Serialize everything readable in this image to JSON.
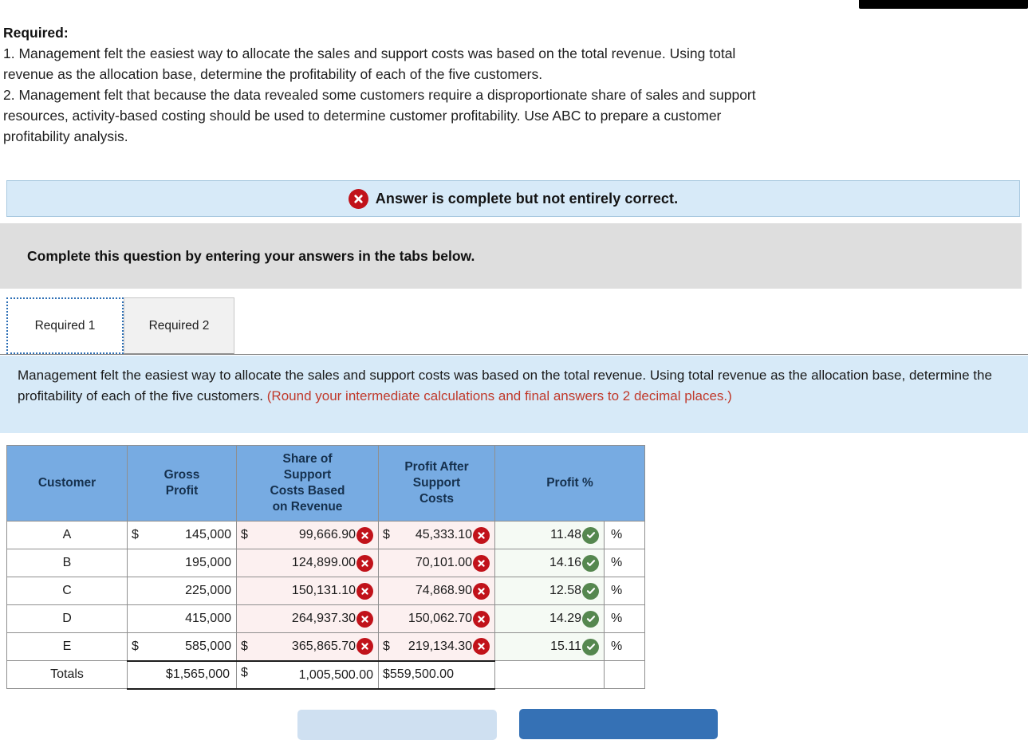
{
  "required": {
    "title": "Required:",
    "item1_line1": "1. Management felt the easiest way to allocate the sales and support costs was based on the total revenue. Using total",
    "item1_line2": "revenue as the allocation base, determine the profitability of each of the five customers.",
    "item2_line1": "2. Management felt that because the data revealed some customers require a disproportionate share of sales and support",
    "item2_line2": "resources, activity-based costing should be used to determine customer profitability. Use ABC to prepare a customer",
    "item2_line3": "profitability analysis."
  },
  "answer_banner": {
    "text": "Answer is complete but not entirely correct.",
    "icon": "x-circle-icon",
    "icon_color": "#c1121a",
    "background": "#d7eaf8"
  },
  "gray_banner": {
    "text": "Complete this question by entering your answers in the tabs below."
  },
  "tabs": [
    {
      "label": "Required 1",
      "active": true
    },
    {
      "label": "Required 2",
      "active": false
    }
  ],
  "question": {
    "body": "Management felt the easiest way to allocate the sales and support costs was based on the total revenue. Using total revenue as the allocation base, determine the profitability of each of the five customers. ",
    "note": "(Round your intermediate calculations and final answers to 2 decimal places.)",
    "note_color": "#c0392b"
  },
  "table": {
    "header_color": "#77abe2",
    "headers": {
      "customer": "Customer",
      "gross_profit": "Gross\nProfit",
      "gross_profit_l1": "Gross",
      "gross_profit_l2": "Profit",
      "share_l1": "Share of",
      "share_l2": "Support",
      "share_l3": "Costs Based",
      "share_l4": "on Revenue",
      "profit_after_l1": "Profit After",
      "profit_after_l2": "Support",
      "profit_after_l3": "Costs",
      "profit_pct": "Profit %"
    },
    "rows": [
      {
        "customer": "A",
        "gross_dollar": "$",
        "gross": "145,000",
        "share_dollar": "$",
        "share": "99,666.90",
        "share_mark": "incorrect",
        "profit_dollar": "$",
        "profit": "45,333.10",
        "profit_mark": "incorrect",
        "pct": "11.48",
        "pct_mark": "correct",
        "pct_symbol": "%"
      },
      {
        "customer": "B",
        "gross_dollar": "",
        "gross": "195,000",
        "share_dollar": "",
        "share": "124,899.00",
        "share_mark": "incorrect",
        "profit_dollar": "",
        "profit": "70,101.00",
        "profit_mark": "incorrect",
        "pct": "14.16",
        "pct_mark": "correct",
        "pct_symbol": "%"
      },
      {
        "customer": "C",
        "gross_dollar": "",
        "gross": "225,000",
        "share_dollar": "",
        "share": "150,131.10",
        "share_mark": "incorrect",
        "profit_dollar": "",
        "profit": "74,868.90",
        "profit_mark": "incorrect",
        "pct": "12.58",
        "pct_mark": "correct",
        "pct_symbol": "%"
      },
      {
        "customer": "D",
        "gross_dollar": "",
        "gross": "415,000",
        "share_dollar": "",
        "share": "264,937.30",
        "share_mark": "incorrect",
        "profit_dollar": "",
        "profit": "150,062.70",
        "profit_mark": "incorrect",
        "pct": "14.29",
        "pct_mark": "correct",
        "pct_symbol": "%"
      },
      {
        "customer": "E",
        "gross_dollar": "$",
        "gross": "585,000",
        "share_dollar": "$",
        "share": "365,865.70",
        "share_mark": "incorrect",
        "profit_dollar": "$",
        "profit": "219,134.30",
        "profit_mark": "incorrect",
        "pct": "15.11",
        "pct_mark": "correct",
        "pct_symbol": "%"
      }
    ],
    "totals": {
      "label": "Totals",
      "gross_dollar": "$",
      "gross": "1,565,000",
      "share_dollar": "$",
      "share": "1,005,500.00",
      "profit": "$559,500.00"
    }
  }
}
